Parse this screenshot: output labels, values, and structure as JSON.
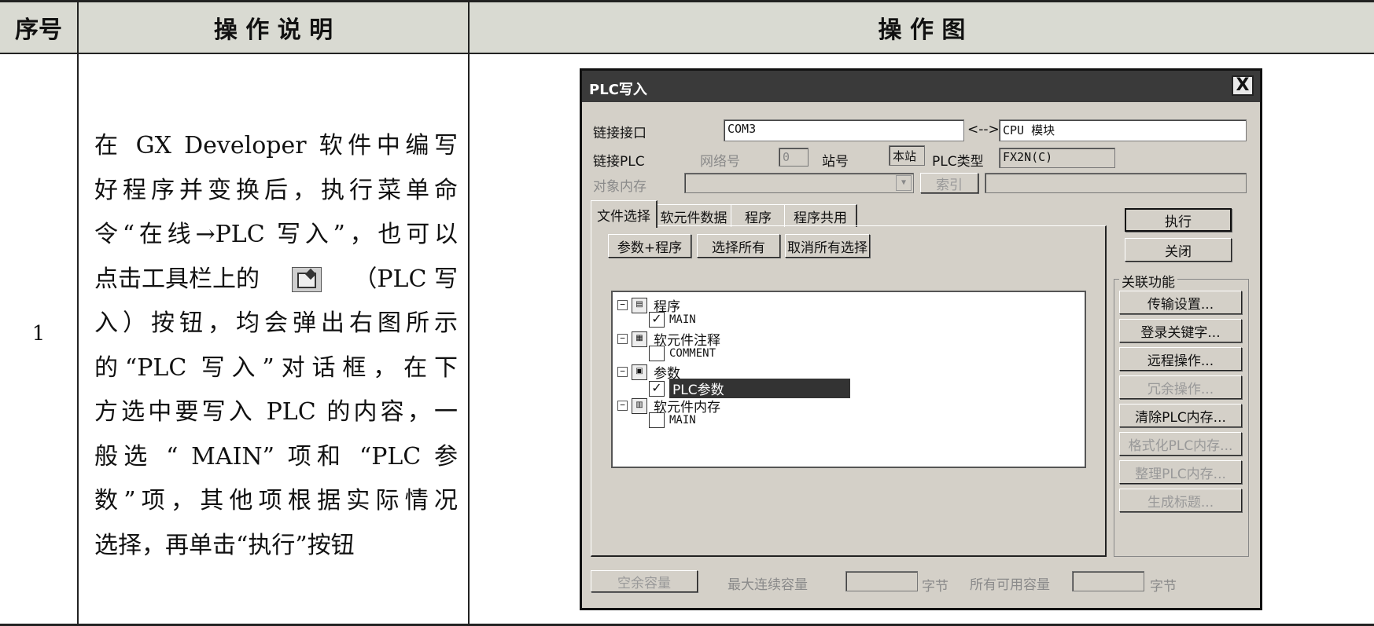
{
  "table": {
    "headers": {
      "index": "序号",
      "description": "操 作 说 明",
      "figure": "操 作 图"
    },
    "row": {
      "index": "1",
      "description_lines": [
        "在 GX Developer 软件中编写",
        "好程序并变换后，执行菜单命",
        "令“在线→PLC 写入”，也可以",
        "点击工具栏上的",
        "（PLC 写",
        "入）按钮，均会弹出右图所示",
        "的“PLC 写入”对话框，在下",
        "方选中要写入 PLC 的内容，一",
        "般选 “ MAIN” 项和 “PLC 参",
        "数”项，其他项根据实际情况",
        "选择，再单击“执行”按钮"
      ],
      "toolbar_icon": "plc-write-icon"
    }
  },
  "dialog": {
    "title": "PLC写入",
    "close_label": "X",
    "link_interface_label": "链接接口",
    "link_interface_value": "COM3",
    "arrow_label": "<-->",
    "cpu_module_value": "CPU 模块",
    "link_plc_label": "链接PLC",
    "network_no_label": "网络号",
    "network_no_value": "0",
    "station_no_label": "站号",
    "station_no_value": "本站",
    "plc_type_label": "PLC类型",
    "plc_type_value": "FX2N(C)",
    "target_memory_label": "对象内存",
    "index_button": "索引",
    "tabs": [
      "文件选择",
      "软元件数据",
      "程序",
      "程序共用"
    ],
    "param_program_button": "参数+程序",
    "select_all_button": "选择所有",
    "deselect_all_button": "取消所有选择",
    "tree": {
      "program": {
        "label": "程序",
        "children": [
          {
            "label": "MAIN",
            "checked": true
          }
        ]
      },
      "comment": {
        "label": "软元件注释",
        "children": [
          {
            "label": "COMMENT",
            "checked": false
          }
        ]
      },
      "params": {
        "label": "参数",
        "children": [
          {
            "label": "PLC参数",
            "checked": true,
            "selected": true
          }
        ]
      },
      "device_memory": {
        "label": "软元件内存",
        "children": [
          {
            "label": "MAIN",
            "checked": false
          }
        ]
      }
    },
    "execute_button": "执行",
    "close_button": "关闭",
    "related_functions_label": "关联功能",
    "related_buttons": [
      {
        "label": "传输设置...",
        "enabled": true
      },
      {
        "label": "登录关键字...",
        "enabled": true
      },
      {
        "label": "远程操作...",
        "enabled": true
      },
      {
        "label": "冗余操作...",
        "enabled": false
      },
      {
        "label": "清除PLC内存...",
        "enabled": true
      },
      {
        "label": "格式化PLC内存...",
        "enabled": false
      },
      {
        "label": "整理PLC内存...",
        "enabled": false
      },
      {
        "label": "生成标题...",
        "enabled": false
      }
    ],
    "free_capacity_button": "空余容量",
    "max_continuous_label": "最大连续容量",
    "bytes_unit_1": "字节",
    "all_available_label": "所有可用容量",
    "bytes_unit_2": "字节"
  }
}
